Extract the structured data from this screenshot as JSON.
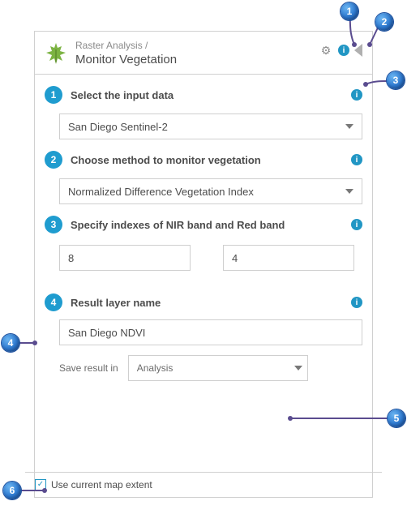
{
  "header": {
    "breadcrumb": "Raster Analysis /",
    "title": "Monitor Vegetation"
  },
  "callouts": {
    "c1": "1",
    "c2": "2",
    "c3": "3",
    "c4": "4",
    "c5": "5",
    "c6": "6"
  },
  "info_glyph": "i",
  "steps": {
    "s1": {
      "num": "1",
      "title": "Select the input data",
      "select": "San Diego Sentinel-2"
    },
    "s2": {
      "num": "2",
      "title": "Choose method to monitor vegetation",
      "select": "Normalized Difference Vegetation Index"
    },
    "s3": {
      "num": "3",
      "title": "Specify indexes of NIR band and Red band",
      "nir": "8",
      "red": "4"
    },
    "s4": {
      "num": "4",
      "title": "Result layer name",
      "value": "San Diego NDVI",
      "save_label": "Save result in",
      "save_value": "Analysis"
    }
  },
  "footer": {
    "use_extent": "Use current map extent",
    "check_mark": "✓"
  }
}
